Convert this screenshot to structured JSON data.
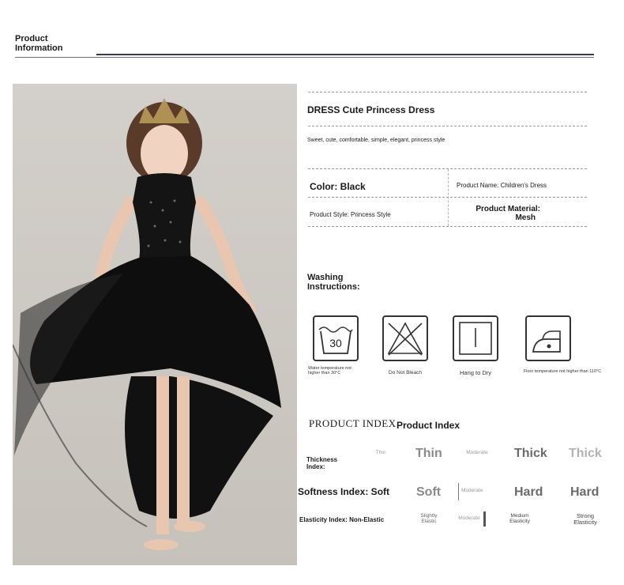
{
  "header": {
    "title_line1": "Product",
    "title_line2": "Information"
  },
  "product": {
    "name": "DRESS Cute Princess Dress",
    "description": "Sweet, cute, comfortable, simple, elegant, princess style",
    "color": "Color: Black",
    "product_name": "Product Name: Children's Dress",
    "style": "Product Style: Princess Style",
    "material_line1": "Product Material:",
    "material_line2": "Mesh"
  },
  "washing": {
    "title_line1": "Washing",
    "title_line2": "Instructions:",
    "icons": [
      {
        "icon": "wash-30-icon",
        "value": "30",
        "label": "Water temperature not higher than 30°C"
      },
      {
        "icon": "do-not-bleach-icon",
        "label": "Do Not Bleach"
      },
      {
        "icon": "hang-dry-icon",
        "label": "Hang to Dry"
      },
      {
        "icon": "iron-icon",
        "label": "Floor temperature not higher than 110°C"
      }
    ]
  },
  "index": {
    "title_cn": "PRODUCT  INDEX",
    "title_en": "Product Index",
    "thickness": {
      "label_line1": "Thickness",
      "label_line2": "Index:",
      "options": [
        "Thin",
        "Thin",
        "Moderate",
        "Thick",
        "Thick"
      ]
    },
    "softness": {
      "label": "Softness Index: Soft",
      "options": [
        "Soft",
        "Moderate",
        "Hard",
        "Hard"
      ]
    },
    "elasticity": {
      "label": "Elasticity Index: Non-Elastic",
      "options": [
        "Slightly Elastic",
        "Moderate",
        "Medium Elasticity",
        "Strong Elasticity"
      ],
      "options_lines": [
        [
          "Slightly",
          "Elastic"
        ],
        [
          "Moderate"
        ],
        [
          "Medium",
          "Elasticity"
        ],
        [
          "Strong",
          "Elasticity"
        ]
      ]
    }
  }
}
